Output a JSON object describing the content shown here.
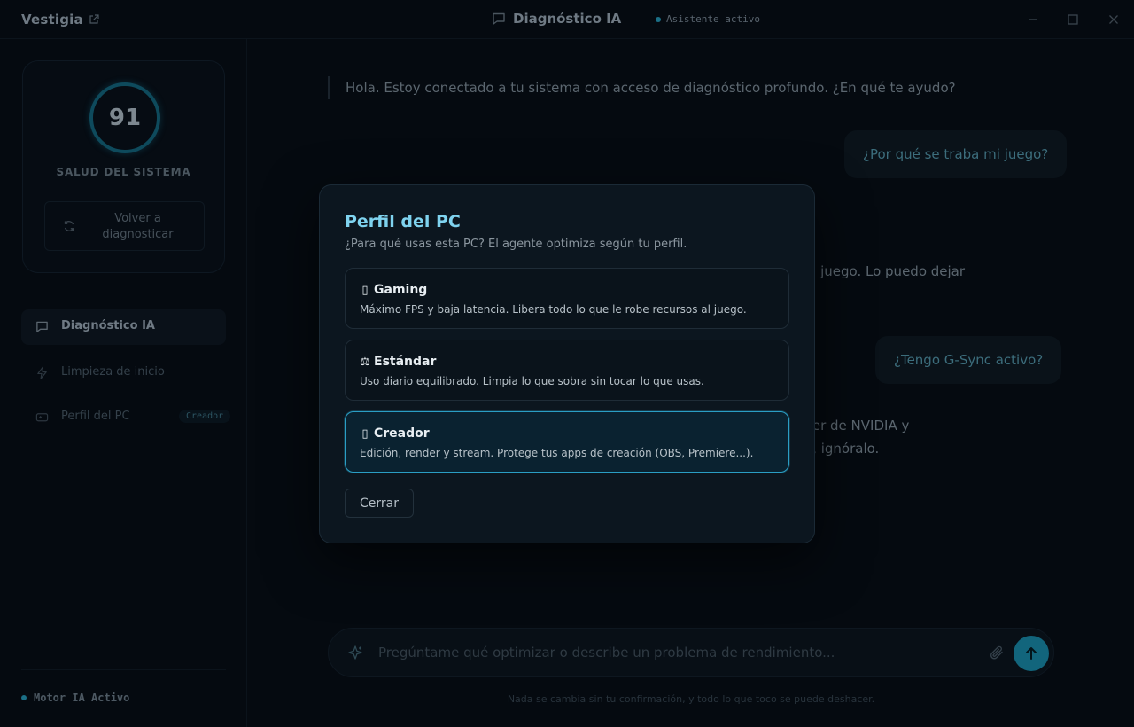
{
  "app": {
    "brand": "Vestigia",
    "section_title": "Diagnóstico IA",
    "assistant_status": "Asistente activo"
  },
  "sidebar": {
    "health_score": "91",
    "health_label": "SALUD DEL SISTEMA",
    "rescan_label_line1": "Volver a",
    "rescan_label_line2": "diagnosticar",
    "nav": [
      {
        "label": "Diagnóstico IA",
        "icon": "chat-icon",
        "active": true
      },
      {
        "label": "Limpieza de inicio",
        "icon": "bolt-icon",
        "active": false
      },
      {
        "label": "Perfil del PC",
        "icon": "gamepad-icon",
        "active": false,
        "badge": "Creador"
      }
    ],
    "engine_status": "Motor IA Activo"
  },
  "chat": {
    "ai_greeting": "Hola. Estoy conectado a tu sistema con acceso de diagnóstico profundo. ¿En qué te ayudo?",
    "user_q1": "¿Por qué se traba mi juego?",
    "ai_partial_1": "al juego. Lo puedo dejar",
    "user_q2": "¿Tengo G-Sync activo?",
    "ai_partial_2_line1": "ver de NVIDIA y",
    "ai_partial_2_line2": "o, ignóralo.",
    "composer_placeholder": "Pregúntame qué optimizar o describe un problema de rendimiento...",
    "footnote": "Nada se cambia sin tu confirmación, y todo lo que toco se puede deshacer."
  },
  "modal": {
    "title": "Perfil del PC",
    "subtitle": "¿Para qué usas esta PC? El agente optimiza según tu perfil.",
    "options": [
      {
        "glyph": "▯",
        "label": "Gaming",
        "desc": "Máximo FPS y baja latencia. Libera todo lo que le robe recursos al juego.",
        "selected": false
      },
      {
        "glyph": "⚖",
        "label": "Estándar",
        "desc": "Uso diario equilibrado. Limpia lo que sobra sin tocar lo que usas.",
        "selected": false
      },
      {
        "glyph": "▯",
        "label": "Creador",
        "desc": "Edición, render y stream. Protege tus apps de creación (OBS, Premiere...).",
        "selected": true
      }
    ],
    "close_label": "Cerrar"
  },
  "colors": {
    "accent": "#7fd3ef",
    "selected_border": "#2a9ec4",
    "send_button": "#12657c",
    "modal_bg": "#0c161f",
    "app_bg": "#050a10"
  }
}
